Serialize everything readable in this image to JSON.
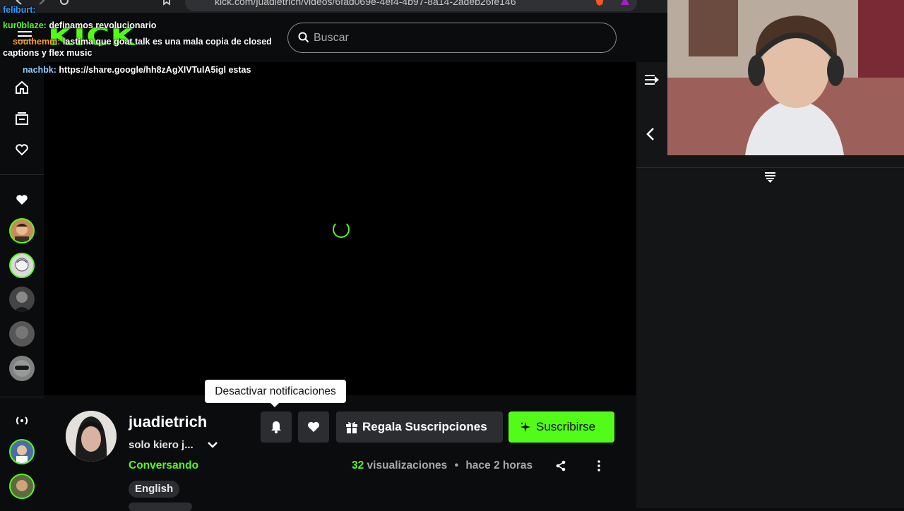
{
  "browser": {
    "url": "kick.com/juadietrich/videos/6fad069e-4ef4-4b97-8a14-2adeb26fe146"
  },
  "header": {
    "logo": "KICK",
    "search_placeholder": "Buscar"
  },
  "chat_overlay": [
    {
      "user": "feliburt:",
      "text": "",
      "user_color": "#2f9bff"
    },
    {
      "user": "kur0blaze:",
      "text": " definamos revolucionario",
      "user_color": "#53fc18"
    },
    {
      "user": "southemm:",
      "text": " lastima que goat talk es una mala copia de closed captions y flex music",
      "user_color": "#ff9f1c"
    },
    {
      "user": "nachbk:",
      "text": " https://share.google/hh8zAgXIVTulA5igl estas",
      "user_color": "#8fd0ff"
    }
  ],
  "tooltip": "Desactivar notificaciones",
  "channel": {
    "name": "juadietrich",
    "stream_title": "solo kiero j...",
    "category": "Conversando",
    "tag": "English"
  },
  "actions": {
    "gift_label": "Regala Suscripciones",
    "subscribe_label": "Suscribirse"
  },
  "meta": {
    "views_count": "32",
    "views_label": " visualizaciones",
    "separator": "•",
    "time_ago": "hace 2 horas"
  },
  "colors": {
    "accent": "#53fc18",
    "background": "#0b0c0d",
    "button_bg": "#2b2d30"
  },
  "icons": [
    "home-icon",
    "browse-icon",
    "heart-outline-icon",
    "heart-icon",
    "live-signal-icon",
    "bell-icon",
    "gift-icon",
    "sparkle-icon",
    "share-icon",
    "more-icon",
    "chevron-down-icon",
    "collapse-chat-icon",
    "chevron-left-icon",
    "filter-icon",
    "search-icon",
    "menu-icon"
  ]
}
